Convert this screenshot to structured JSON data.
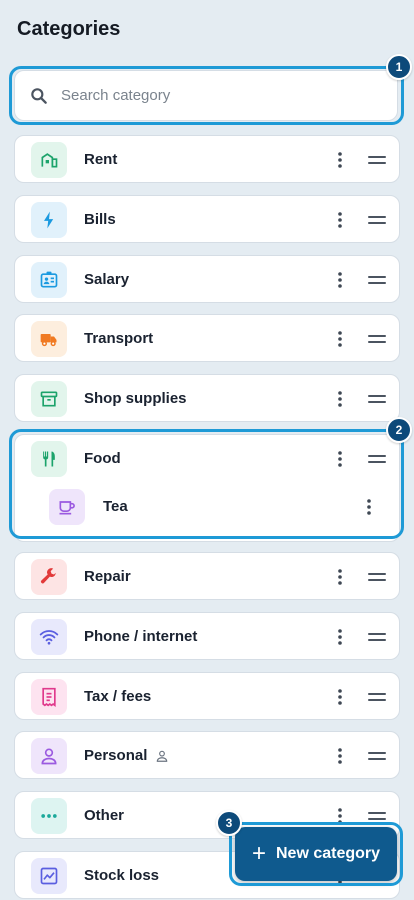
{
  "header": {
    "title": "Categories"
  },
  "search": {
    "placeholder": "Search category"
  },
  "categories": [
    {
      "label": "Rent",
      "icon": "building-icon",
      "color": "#1ca36b",
      "bg": "#e2f5ec"
    },
    {
      "label": "Bills",
      "icon": "lightning-icon",
      "color": "#1b9ae0",
      "bg": "#e1f1fb"
    },
    {
      "label": "Salary",
      "icon": "id-badge-icon",
      "color": "#1b9ae0",
      "bg": "#e1f1fb"
    },
    {
      "label": "Transport",
      "icon": "truck-icon",
      "color": "#f07a22",
      "bg": "#fdeede"
    },
    {
      "label": "Shop supplies",
      "icon": "archive-box-icon",
      "color": "#1ca36b",
      "bg": "#e2f5ec"
    },
    {
      "label": "Food",
      "icon": "fork-knife-icon",
      "color": "#1ca36b",
      "bg": "#e2f5ec",
      "children": [
        {
          "label": "Tea",
          "icon": "cup-icon",
          "color": "#9b5ae0",
          "bg": "#efe5fb"
        }
      ]
    },
    {
      "label": "Repair",
      "icon": "wrench-icon",
      "color": "#e23a3a",
      "bg": "#fde4e4"
    },
    {
      "label": "Phone / internet",
      "icon": "wifi-icon",
      "color": "#5a5ee0",
      "bg": "#e8e9fc"
    },
    {
      "label": "Tax / fees",
      "icon": "receipt-icon",
      "color": "#e0398c",
      "bg": "#fde3f0"
    },
    {
      "label": "Personal",
      "icon": "person-icon",
      "color": "#9b5ae0",
      "bg": "#efe5fb",
      "personal_marker": true
    },
    {
      "label": "Other",
      "icon": "dots-icon",
      "color": "#1aa89a",
      "bg": "#ddf4f1"
    },
    {
      "label": "Stock loss",
      "icon": "chart-icon",
      "color": "#5a5ee0",
      "bg": "#e8e9fc"
    }
  ],
  "fab": {
    "label": "New category",
    "plus": "+"
  },
  "annotations": {
    "badge_1": "1",
    "badge_2": "2",
    "badge_3": "3"
  },
  "colors": {
    "accent": "#0f5a8e",
    "highlight": "#1e9ad6"
  }
}
